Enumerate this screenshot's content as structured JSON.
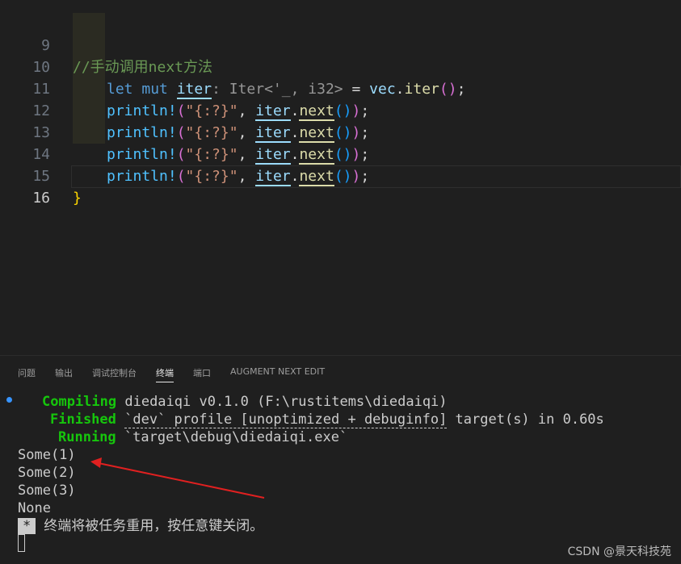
{
  "editor": {
    "lines": [
      {
        "num": "9"
      },
      {
        "num": "10"
      },
      {
        "num": "11"
      },
      {
        "num": "12"
      },
      {
        "num": "13"
      },
      {
        "num": "14"
      },
      {
        "num": "15"
      },
      {
        "num": "16"
      }
    ],
    "comment": "//手动调用next方法",
    "let_kw": "let",
    "mut_kw": "mut",
    "iter_var": "iter",
    "type_hint": ": Iter<'_, i32>",
    "assign": " = ",
    "vec_var": "vec",
    "dot": ".",
    "iter_fn": "iter",
    "println": "println!",
    "fmt_str": "\"{:?}\"",
    "comma": ", ",
    "next_fn": "next",
    "semicolon": ";",
    "open_paren": "(",
    "close_paren": ")",
    "close_brace": "}"
  },
  "panel": {
    "tabs": [
      "问题",
      "输出",
      "调试控制台",
      "终端",
      "端口",
      "AUGMENT NEXT EDIT"
    ],
    "active_tab": "终端"
  },
  "terminal": {
    "compiling_label": "Compiling",
    "compiling_text": " diedaiqi v0.1.0 (F:\\rustitems\\diedaiqi)",
    "finished_label": "Finished",
    "finished_text_pre": " ",
    "finished_profile": "`dev` profile [unoptimized + debuginfo]",
    "finished_text_post": " target(s) in 0.60s",
    "running_label": "Running",
    "running_text": " `target\\debug\\diedaiqi.exe`",
    "outputs": [
      "Some(1)",
      "Some(2)",
      "Some(3)",
      "None"
    ],
    "reuse_star": "*",
    "reuse_msg": "终端将被任务重用，按任意键关闭。"
  },
  "watermark": "CSDN @景天科技苑",
  "colors": {
    "annotation_arrow": "#e02020",
    "running_green": "#16c60c",
    "status_dot": "#3794ff"
  }
}
